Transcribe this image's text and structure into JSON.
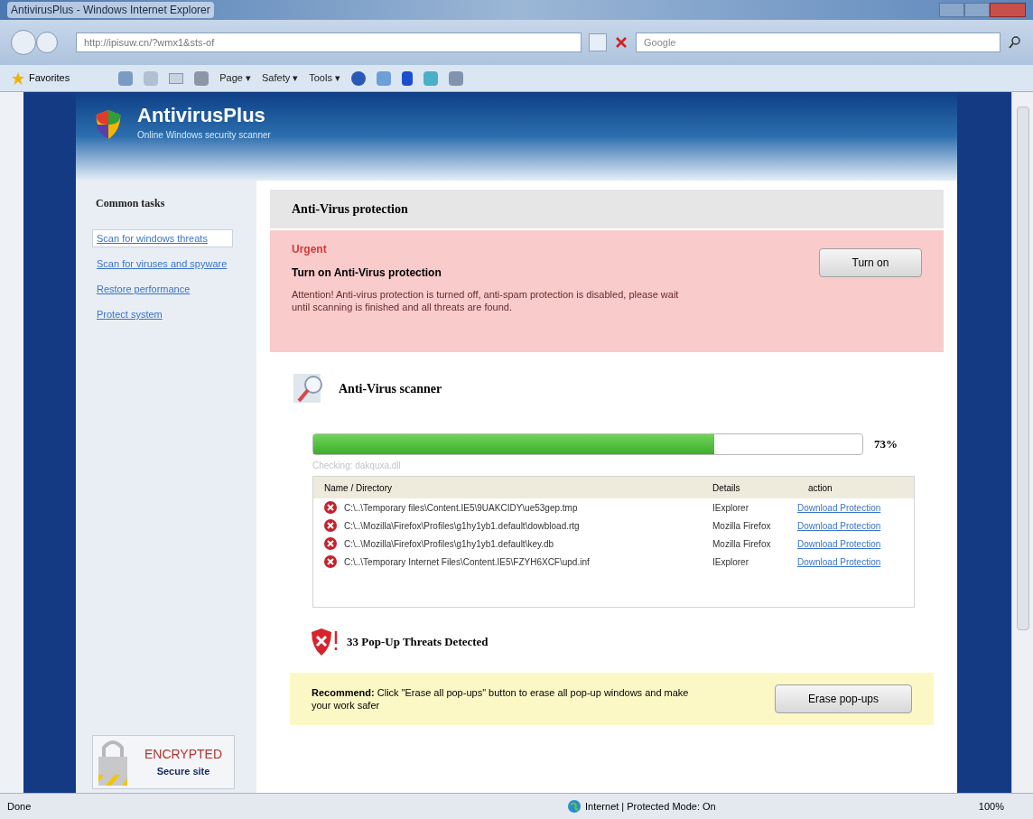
{
  "window": {
    "title": "AntivirusPlus - Windows Internet Explorer"
  },
  "address_bar": {
    "url": "http://ipisuw.cn/?wmx1&sts-of",
    "search_placeholder": "Google"
  },
  "command_bar": {
    "favorites": "Favorites",
    "menus": [
      "Page ▾",
      "Safety ▾",
      "Tools ▾"
    ]
  },
  "site": {
    "name": "AntivirusPlus",
    "tagline": "Online Windows security scanner"
  },
  "sidebar": {
    "title": "Common tasks",
    "items": [
      {
        "label": "Scan for windows threats",
        "selected": true
      },
      {
        "label": "Scan for viruses and spyware",
        "selected": false
      },
      {
        "label": "Restore performance",
        "selected": false
      },
      {
        "label": "Protect system",
        "selected": false
      }
    ],
    "badge": {
      "title": "ENCRYPTED",
      "subtitle": "Secure site"
    }
  },
  "panel": {
    "title": "Anti-Virus protection",
    "alert": {
      "label": "Urgent",
      "heading": "Turn on Anti-Virus protection",
      "message": "Attention! Anti-virus protection is turned off, anti-spam protection is disabled, please wait until scanning is finished and all threats are found.",
      "button": "Turn on"
    },
    "scanner": {
      "title": "Anti-Virus scanner",
      "level": 0.73,
      "percent": "73%",
      "checking": "Checking: dakquxa.dll",
      "columns": [
        "Name / Directory",
        "Details",
        "action"
      ],
      "rows": [
        {
          "path": "C:\\..\\Temporary files\\Content.IE5\\9UAKCIDY\\ue53gep.tmp",
          "details": "IExplorer",
          "action": "Download Protection"
        },
        {
          "path": "C:\\..\\Mozilla\\Firefox\\Profiles\\g1hy1yb1.default\\dowbload.rtg",
          "details": "Mozilla Firefox",
          "action": "Download Protection"
        },
        {
          "path": "C:\\..\\Mozilla\\Firefox\\Profiles\\g1hy1yb1.default\\key.db",
          "details": "Mozilla Firefox",
          "action": "Download Protection"
        },
        {
          "path": "C:\\..\\Temporary Internet Files\\Content.IE5\\FZYH6XCF\\upd.inf",
          "details": "IExplorer",
          "action": "Download Protection"
        }
      ]
    },
    "threats": "33 Pop-Up Threats Detected",
    "recommend": {
      "text": "**Recommend:** Click \"Erase all pop-ups\" button to erase all pop-up windows and make your work safer",
      "button": "Erase pop-ups"
    }
  },
  "status_bar": {
    "text": "Done",
    "zone": "Internet | Protected Mode: On",
    "zoom": "100%"
  }
}
